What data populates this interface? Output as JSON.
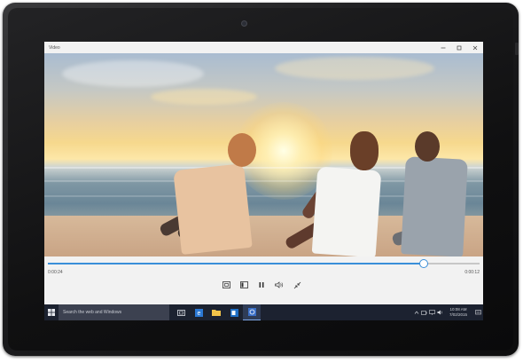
{
  "window": {
    "title": "Video",
    "controls": [
      "minimize",
      "maximize",
      "close"
    ]
  },
  "player": {
    "elapsed": "0:00:24",
    "remaining": "0:00:12",
    "progress_fraction": 0.87,
    "state": "playing"
  },
  "taskbar": {
    "search_placeholder": "Search the web and Windows",
    "pinned_icons": [
      "task-view-icon",
      "edge-icon",
      "file-explorer-icon",
      "outlook-icon",
      "video-app-icon"
    ],
    "clock_time": "10:08 AM",
    "clock_date": "7/02/2015"
  },
  "colors": {
    "accent": "#3a8fd9",
    "taskbar": "#1c2230",
    "window_chrome": "#f2f2f2"
  }
}
